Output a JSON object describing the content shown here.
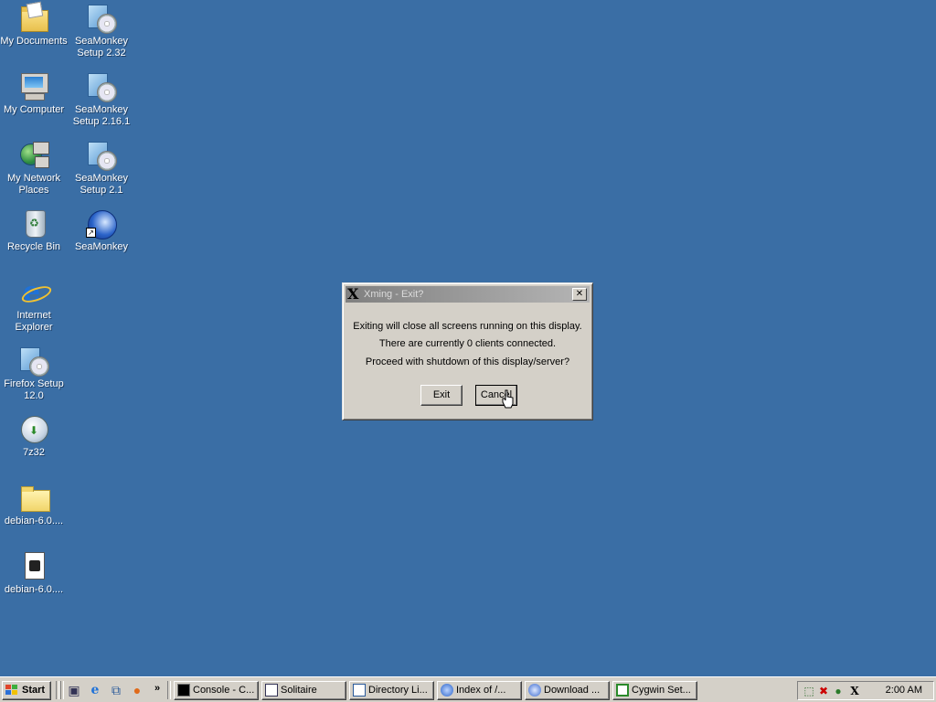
{
  "desktop": {
    "icons": [
      {
        "label": "My Documents",
        "icon": "my-documents-icon"
      },
      {
        "label": "SeaMonkey Setup 2.32",
        "icon": "seamonkey-setup-icon"
      },
      {
        "label": "My Computer",
        "icon": "my-computer-icon"
      },
      {
        "label": "SeaMonkey Setup 2.16.1",
        "icon": "seamonkey-setup-icon"
      },
      {
        "label": "My Network Places",
        "icon": "network-places-icon"
      },
      {
        "label": "SeaMonkey Setup 2.1",
        "icon": "seamonkey-setup-icon"
      },
      {
        "label": "Recycle Bin",
        "icon": "recycle-bin-icon"
      },
      {
        "label": "SeaMonkey",
        "icon": "seamonkey-icon"
      },
      {
        "label": "Internet Explorer",
        "icon": "internet-explorer-icon"
      },
      {
        "label": "Firefox Setup 12.0",
        "icon": "firefox-setup-icon"
      },
      {
        "label": "7z32",
        "icon": "7zip-installer-icon"
      },
      {
        "label": "debian-6.0....",
        "icon": "folder-icon"
      },
      {
        "label": "debian-6.0....",
        "icon": "file-icon"
      }
    ]
  },
  "dialog": {
    "title": "Xming - Exit?",
    "line1": "Exiting will close all screens running on this display.",
    "line2": "There are currently 0 clients connected.",
    "line3": "Proceed with shutdown of this display/server?",
    "exit_label": "Exit",
    "cancel_label": "Cancel",
    "close_glyph": "✕"
  },
  "taskbar": {
    "start_label": "Start",
    "tasks": [
      {
        "label": "Console - C...",
        "icon": "console-icon"
      },
      {
        "label": "Solitaire",
        "icon": "solitaire-icon"
      },
      {
        "label": "Directory Li...",
        "icon": "browser-icon"
      },
      {
        "label": "Index of /...",
        "icon": "seamonkey-icon"
      },
      {
        "label": "Download ...",
        "icon": "download-icon"
      },
      {
        "label": "Cygwin Set...",
        "icon": "cygwin-icon"
      }
    ],
    "clock": "2:00 AM",
    "colors": {
      "desktop": "#3a6ea5",
      "face": "#d4d0c8"
    }
  }
}
